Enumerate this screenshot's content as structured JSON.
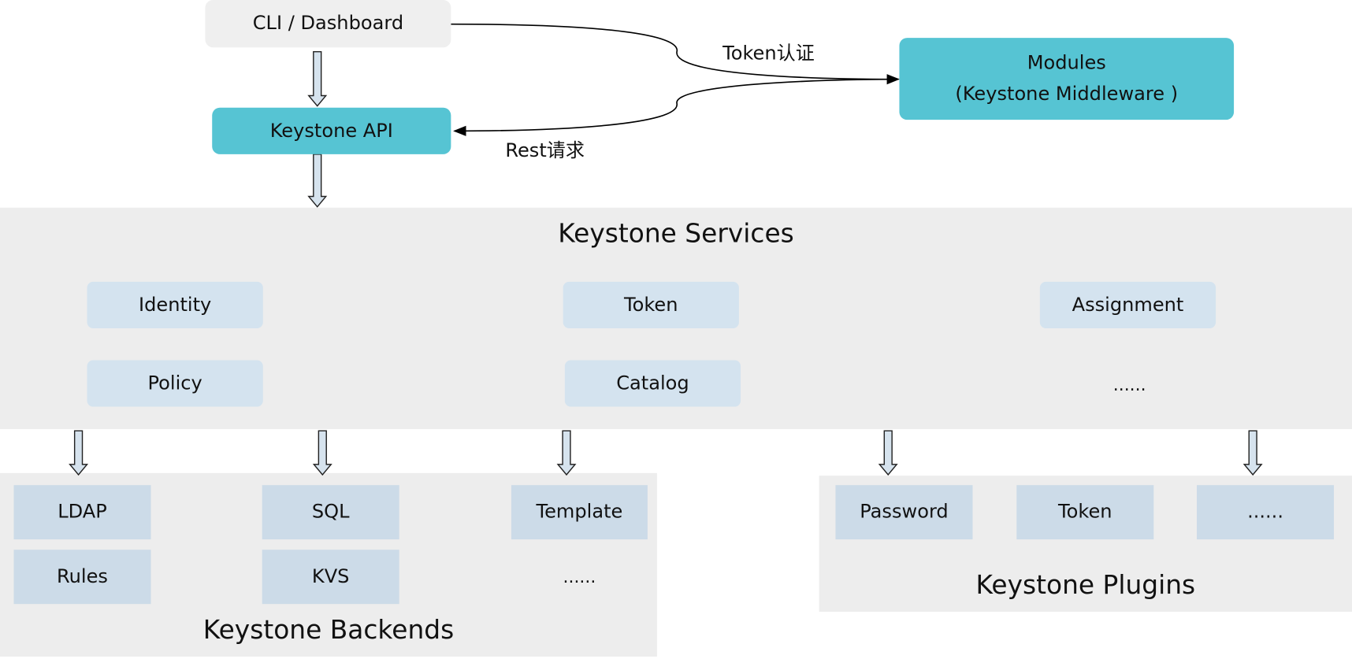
{
  "top": {
    "cli": "CLI / Dashboard",
    "api": "Keystone API",
    "modules_line1": "Modules",
    "modules_line2": "(Keystone Middleware )",
    "token_auth": "Token认证",
    "rest_request": "Rest请求"
  },
  "services": {
    "title": "Keystone Services",
    "items": [
      "Identity",
      "Token",
      "Assignment",
      "Policy",
      "Catalog",
      "......"
    ]
  },
  "backends": {
    "title": "Keystone Backends",
    "items": [
      "LDAP",
      "SQL",
      "Template",
      "Rules",
      "KVS",
      "......"
    ]
  },
  "plugins": {
    "title": "Keystone Plugins",
    "items": [
      "Password",
      "Token",
      "......"
    ]
  },
  "colors": {
    "teal": "#56c4d3",
    "panel": "#ededed",
    "service_box": "#d4e3ef",
    "backend_box": "#ccdbe8",
    "arrow_fill": "#d6e3ee"
  }
}
